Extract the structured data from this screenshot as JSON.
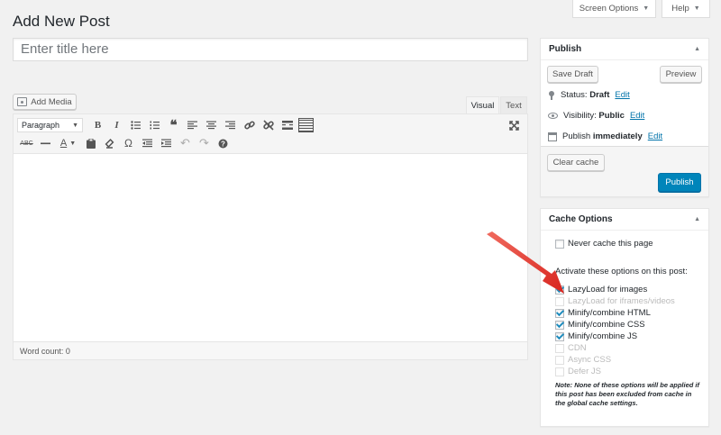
{
  "page": {
    "title": "Add New Post"
  },
  "top_tabs": {
    "screen_options": "Screen Options",
    "help": "Help"
  },
  "title_field": {
    "placeholder": "Enter title here"
  },
  "editor": {
    "add_media": "Add Media",
    "tabs": {
      "visual": "Visual",
      "text": "Text"
    },
    "format_select": "Paragraph",
    "word_count": "Word count: 0"
  },
  "publish": {
    "title": "Publish",
    "save_draft": "Save Draft",
    "preview": "Preview",
    "status_label": "Status:",
    "status_value": "Draft",
    "visibility_label": "Visibility:",
    "visibility_value": "Public",
    "schedule_label": "Publish",
    "schedule_value": "immediately",
    "edit_link": "Edit",
    "clear_cache": "Clear cache",
    "publish_button": "Publish"
  },
  "cache_options": {
    "title": "Cache Options",
    "never_cache": "Never cache this page",
    "heading": "Activate these options on this post:",
    "options": [
      {
        "label": "LazyLoad for images",
        "checked": true,
        "disabled": false
      },
      {
        "label": "LazyLoad for iframes/videos",
        "checked": false,
        "disabled": true
      },
      {
        "label": "Minify/combine HTML",
        "checked": true,
        "disabled": false
      },
      {
        "label": "Minify/combine CSS",
        "checked": true,
        "disabled": false
      },
      {
        "label": "Minify/combine JS",
        "checked": true,
        "disabled": false
      },
      {
        "label": "CDN",
        "checked": false,
        "disabled": true
      },
      {
        "label": "Async CSS",
        "checked": false,
        "disabled": true
      },
      {
        "label": "Defer JS",
        "checked": false,
        "disabled": true
      }
    ],
    "note": "Note: None of these options will be applied if this post has been excluded from cache in the global cache settings."
  },
  "colors": {
    "primary": "#0085ba",
    "link": "#0073aa",
    "arrow": "#e63a36"
  }
}
